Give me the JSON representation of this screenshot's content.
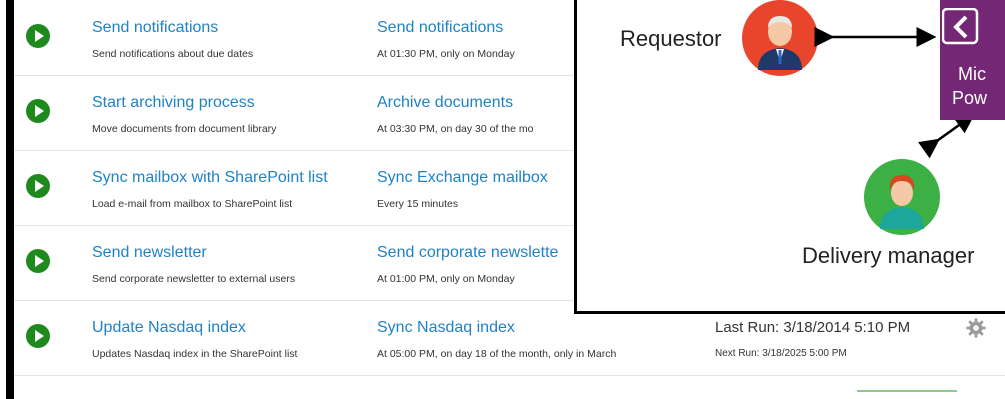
{
  "tasks": [
    {
      "title": "Send notifications",
      "desc": "Send notifications about due dates",
      "schedule_title": "Send notifications",
      "schedule_desc": "At 01:30 PM, only on Monday"
    },
    {
      "title": "Start archiving process",
      "desc": "Move documents from document library",
      "schedule_title": "Archive documents",
      "schedule_desc": "At 03:30 PM, on day 30 of the mo"
    },
    {
      "title": "Sync mailbox with SharePoint list",
      "desc": "Load e-mail from mailbox to SharePoint list",
      "schedule_title": "Sync Exchange mailbox",
      "schedule_desc": "Every 15 minutes"
    },
    {
      "title": "Send newsletter",
      "desc": "Send corporate newsletter to external users",
      "schedule_title": "Send corporate newslette",
      "schedule_desc": "At 01:00 PM, only on Monday"
    },
    {
      "title": "Update Nasdaq index",
      "desc": "Updates Nasdaq index in the SharePoint list",
      "schedule_title": "Sync Nasdaq index",
      "schedule_desc": "At 05:00 PM, on day 18 of the month, only in March",
      "last_run": "Last Run: 3/18/2014 5:10 PM",
      "next_run": "Next Run: 3/18/2025 5:00 PM"
    }
  ],
  "overlay": {
    "requestor_label": "Requestor",
    "delivery_label": "Delivery manager",
    "product_line1": "Mic",
    "product_line2": "Pow"
  },
  "icons": {
    "run": "play-icon",
    "settings": "gear-icon",
    "requestor": "person-avatar-icon",
    "delivery": "person-avatar-icon",
    "power_automate": "power-automate-logo"
  },
  "colors": {
    "link": "#1f82c6",
    "run_button": "#1e8a1e",
    "power_automate": "#742774",
    "requestor_circle": "#e8452c",
    "delivery_circle": "#3cb045"
  }
}
